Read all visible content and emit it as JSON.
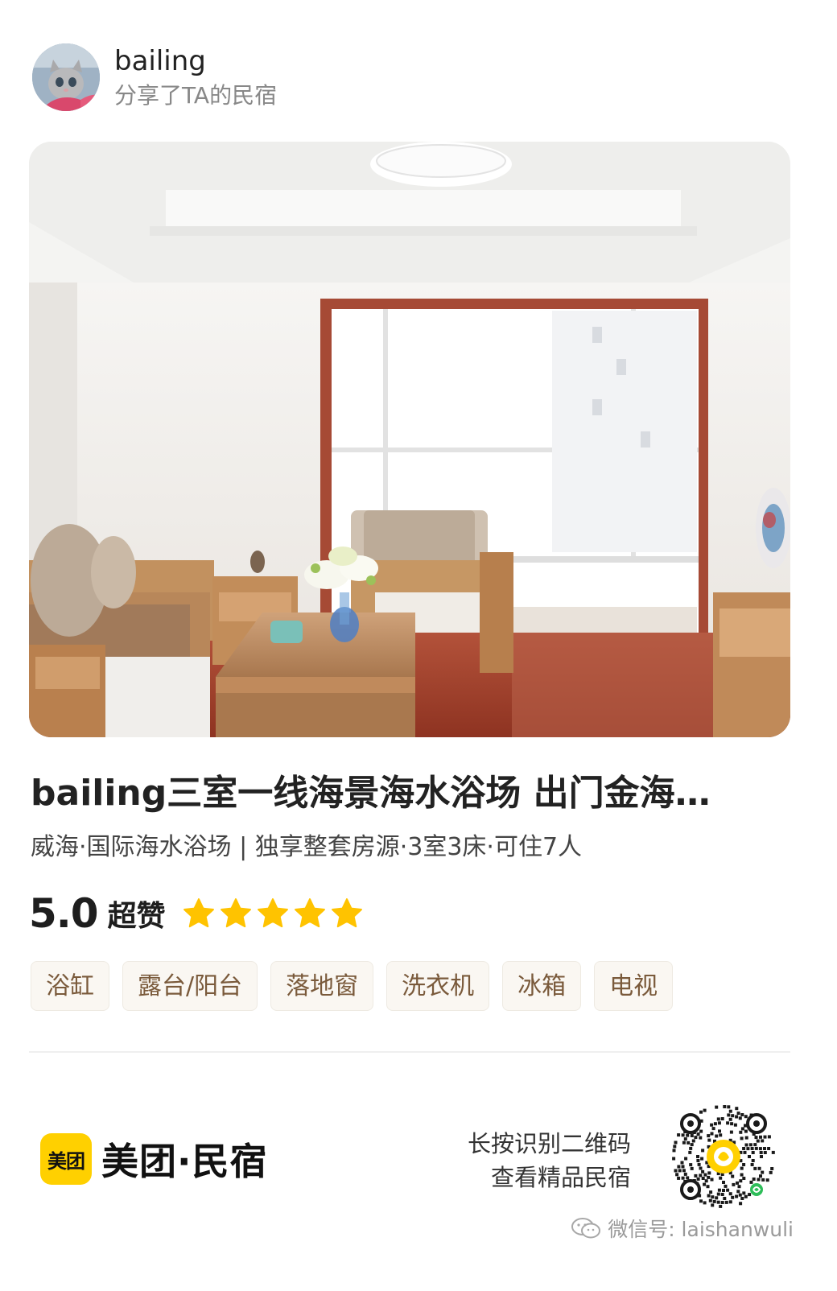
{
  "user": {
    "name": "bailing",
    "subtitle": "分享了TA的民宿"
  },
  "listing": {
    "title": "bailing三室一线海景海水浴场 出门金海…",
    "meta": "威海·国际海水浴场 | 独享整套房源·3室3床·可住7人",
    "photo_icon": "living-room-photo"
  },
  "rating": {
    "score": "5.0",
    "label": "超赞",
    "stars": 5,
    "star_color": "#FFC300"
  },
  "amenities": [
    "浴缸",
    "露台/阳台",
    "落地窗",
    "洗衣机",
    "冰箱",
    "电视"
  ],
  "footer": {
    "logo_text": "美团",
    "brand_name": "美团·民宿",
    "brand_color": "#FFD000",
    "qr_caption_line1": "长按识别二维码",
    "qr_caption_line2": "查看精品民宿",
    "qr_icon": "mini-program-qr-code"
  },
  "watermark": {
    "text": "微信号: laishanwuli",
    "icon": "wechat-icon"
  }
}
